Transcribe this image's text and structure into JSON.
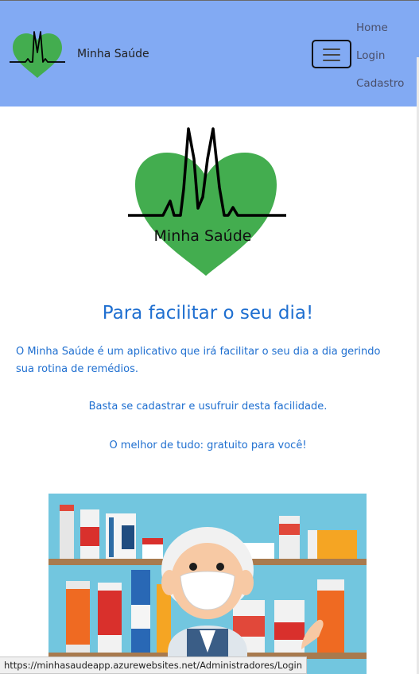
{
  "navbar": {
    "brand_name": "Minha Saúde",
    "links": [
      "Home",
      "Login",
      "Cadastro"
    ],
    "bg_color": "#82aaf3"
  },
  "hero": {
    "logo_text": "Minha Saúde",
    "headline": "Para facilitar o seu dia!",
    "intro": "O Minha Saúde é um aplicativo que irá facilitar o seu dia a dia gerindo sua rotina de remédios.",
    "cta": "Basta se cadastrar e usufruir desta facilidade.",
    "bonus": "O melhor de tudo: gratuito para você!"
  },
  "illustration": {
    "icon": "pharmacist-illustration-icon"
  },
  "status_bar": {
    "url": "https://minhasaudeapp.azurewebsites.net/Administradores/Login"
  },
  "colors": {
    "accent": "#1f6fd0",
    "heart_green": "#43ad4f",
    "pharmacy_bg": "#72c6df"
  }
}
